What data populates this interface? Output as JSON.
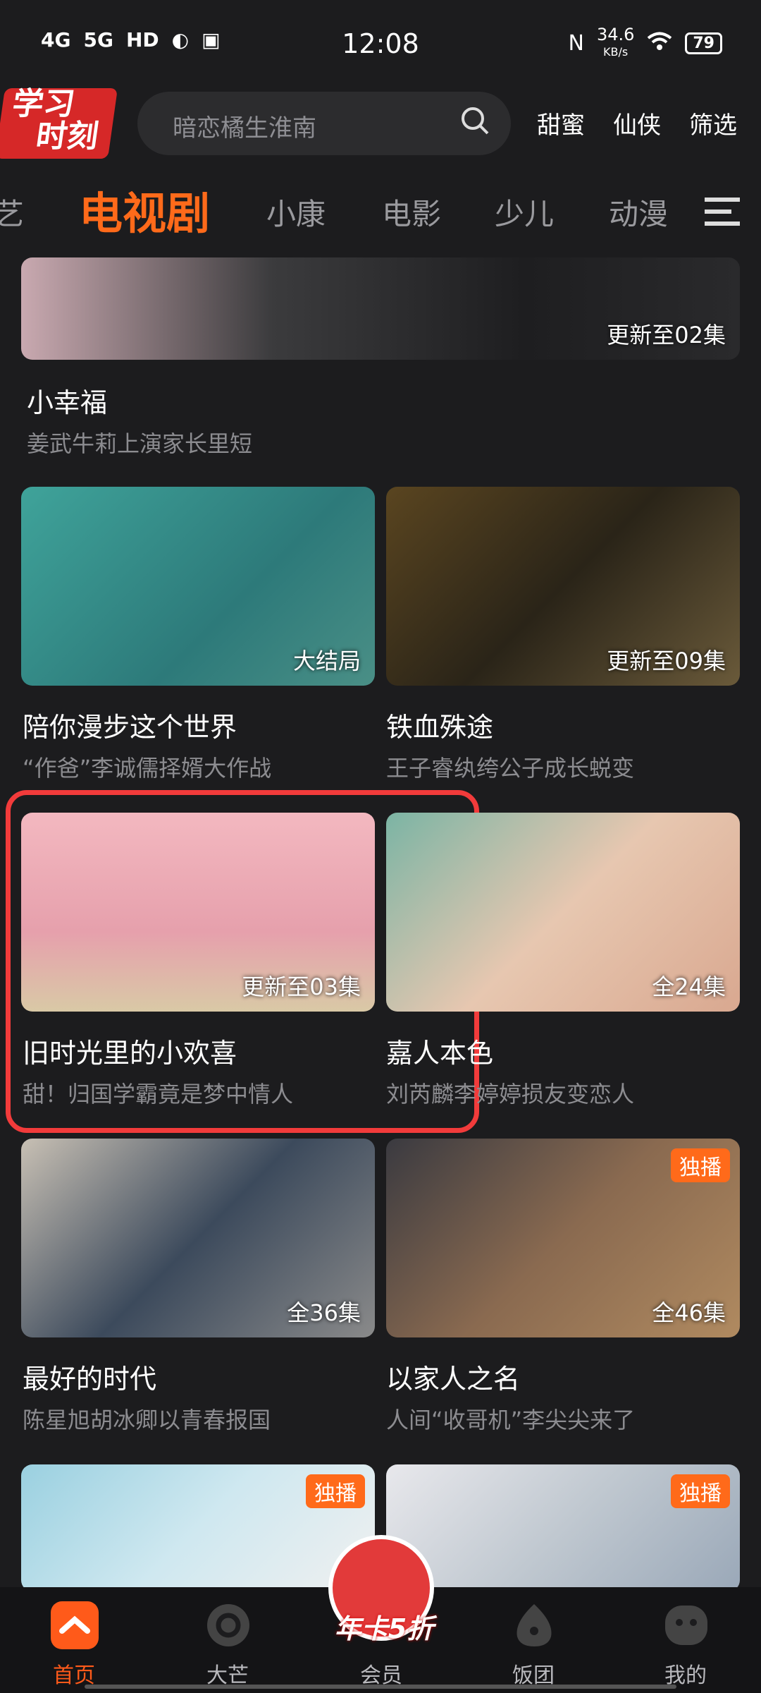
{
  "status_bar": {
    "network1": "4G",
    "network2": "5G",
    "hd": "HD",
    "time": "12:08",
    "speed": "34.6",
    "speed_unit": "KB/s",
    "battery": "79"
  },
  "header": {
    "logo_line1": "学习",
    "logo_line2": "时刻",
    "search_placeholder": "暗恋橘生淮南",
    "quick_links": [
      "甜蜜",
      "仙侠",
      "筛选"
    ]
  },
  "tabs": [
    "艺",
    "电视剧",
    "小康",
    "电影",
    "少儿",
    "动漫"
  ],
  "active_tab": "电视剧",
  "cards": [
    {
      "title": "小幸福",
      "subtitle": "姜武牛莉上演家长里短",
      "badge": "更新至02集",
      "exclusive": ""
    },
    {
      "title": "陪你漫步这个世界",
      "subtitle": "“作爸”李诚儒择婿大作战",
      "badge": "大结局",
      "exclusive": ""
    },
    {
      "title": "铁血殊途",
      "subtitle": "王子睿纨绔公子成长蜕变",
      "badge": "更新至09集",
      "exclusive": ""
    },
    {
      "title": "旧时光里的小欢喜",
      "subtitle": "甜！归国学霸竟是梦中情人",
      "badge": "更新至03集",
      "exclusive": ""
    },
    {
      "title": "嘉人本色",
      "subtitle": "刘芮麟李婷婷损友变恋人",
      "badge": "全24集",
      "exclusive": ""
    },
    {
      "title": "最好的时代",
      "subtitle": "陈星旭胡冰卿以青春报国",
      "badge": "全36集",
      "exclusive": ""
    },
    {
      "title": "以家人之名",
      "subtitle": "人间“收哥机”李尖尖来了",
      "badge": "全46集",
      "exclusive": "独播"
    },
    {
      "title": "",
      "subtitle": "",
      "badge": "",
      "exclusive": "独播"
    },
    {
      "title": "",
      "subtitle": "",
      "badge": "",
      "exclusive": "独播"
    }
  ],
  "bottom_nav": [
    {
      "label": "首页",
      "icon": "home-icon",
      "active": true
    },
    {
      "label": "大芒",
      "icon": "mango-icon",
      "active": false
    },
    {
      "label": "会员",
      "icon": "vip-icon",
      "active": false
    },
    {
      "label": "饭团",
      "icon": "fan-group-icon",
      "active": false
    },
    {
      "label": "我的",
      "icon": "profile-icon",
      "active": false
    }
  ],
  "vip_promo": "年卡5折",
  "colors": {
    "accent": "#ff6a1a",
    "highlight": "#f23b3b",
    "background": "#1c1c1e"
  }
}
